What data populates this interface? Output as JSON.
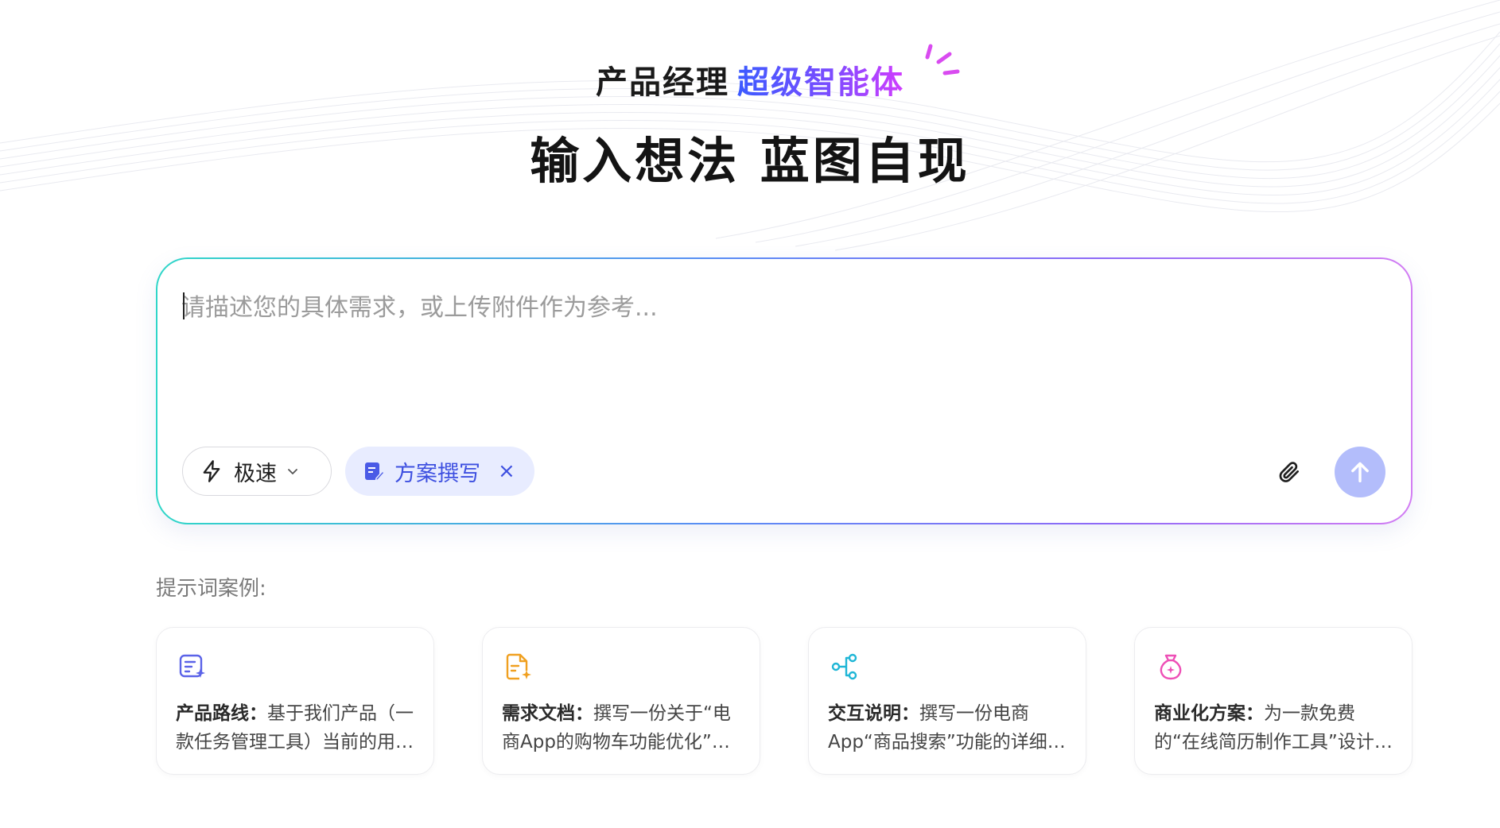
{
  "hero": {
    "subtitle_plain": "产品经理",
    "subtitle_accent": "超级智能体",
    "title": "输入想法 蓝图自现"
  },
  "composer": {
    "placeholder": "请描述您的具体需求，或上传附件作为参考...",
    "value": "",
    "mode": {
      "label": "极速",
      "icon": "lightning-icon"
    },
    "skill_chip": {
      "label": "方案撰写",
      "icon": "document-edit-icon",
      "close": "×"
    },
    "attach_icon": "paperclip-icon",
    "send_icon": "arrow-up-icon"
  },
  "examples": {
    "label": "提示词案例:",
    "cards": [
      {
        "icon": "list-sparkle-icon",
        "color": "#5b63e8",
        "title": "产品路线",
        "sep": "：",
        "body": "基于我们产品（一款任务管理工具）当前的用户反馈和市场趋势，规划未来的产品路线图"
      },
      {
        "icon": "file-sparkle-icon",
        "color": "#f0a020",
        "title": "需求文档",
        "sep": "：",
        "body": "撰写一份关于“电商App的购物车功能优化”的需求文档"
      },
      {
        "icon": "flow-nodes-icon",
        "color": "#1fb6d6",
        "title": "交互说明",
        "sep": "：",
        "body": "撰写一份电商App“商品搜索”功能的详细交互说明"
      },
      {
        "icon": "money-bag-icon",
        "color": "#ee4fb6",
        "title": "商业化方案",
        "sep": "：",
        "body": "为一款免费的“在线简历制作工具”设计商业化方案"
      }
    ]
  },
  "colors": {
    "accent_blue": "#3b5bff",
    "accent_purple": "#d13cff",
    "send_button": "#b3bdfb",
    "chip_bg": "#e8ecff"
  }
}
